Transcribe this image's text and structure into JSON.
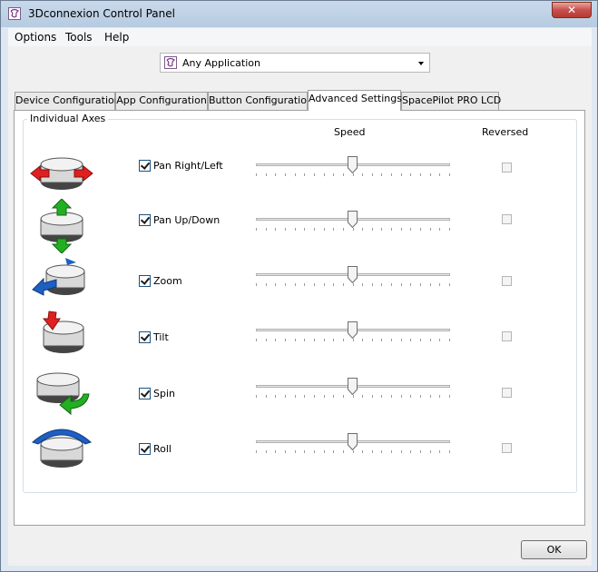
{
  "window": {
    "title": "3Dconnexion Control Panel",
    "close_label": "✕"
  },
  "menu": [
    {
      "label": "Options"
    },
    {
      "label": "Tools"
    },
    {
      "label": "Help"
    }
  ],
  "app_selector": {
    "value": "Any Application"
  },
  "tabs": [
    {
      "label": "Device Configuration",
      "active": false
    },
    {
      "label": "App Configuration",
      "active": false
    },
    {
      "label": "Button Configuration",
      "active": false
    },
    {
      "label": "Advanced Settings",
      "active": true
    },
    {
      "label": "SpacePilot PRO LCD",
      "active": false
    }
  ],
  "panel": {
    "group_title": "Individual Axes",
    "speed_header": "Speed",
    "reversed_header": "Reversed",
    "axes": [
      {
        "label": "Pan Right/Left",
        "enabled": true,
        "speed": 0.5,
        "reversed": false,
        "icon": "pan-right-left-icon"
      },
      {
        "label": "Pan Up/Down",
        "enabled": true,
        "speed": 0.5,
        "reversed": false,
        "icon": "pan-up-down-icon"
      },
      {
        "label": "Zoom",
        "enabled": true,
        "speed": 0.5,
        "reversed": false,
        "icon": "zoom-icon"
      },
      {
        "label": "Tilt",
        "enabled": true,
        "speed": 0.5,
        "reversed": false,
        "icon": "tilt-icon"
      },
      {
        "label": "Spin",
        "enabled": true,
        "speed": 0.5,
        "reversed": false,
        "icon": "spin-icon"
      },
      {
        "label": "Roll",
        "enabled": true,
        "speed": 0.5,
        "reversed": false,
        "icon": "roll-icon"
      }
    ]
  },
  "footer": {
    "ok_label": "OK"
  },
  "colors": {
    "arrow_red": "#e02020",
    "arrow_green": "#22b022",
    "arrow_blue": "#1e5fc2"
  }
}
